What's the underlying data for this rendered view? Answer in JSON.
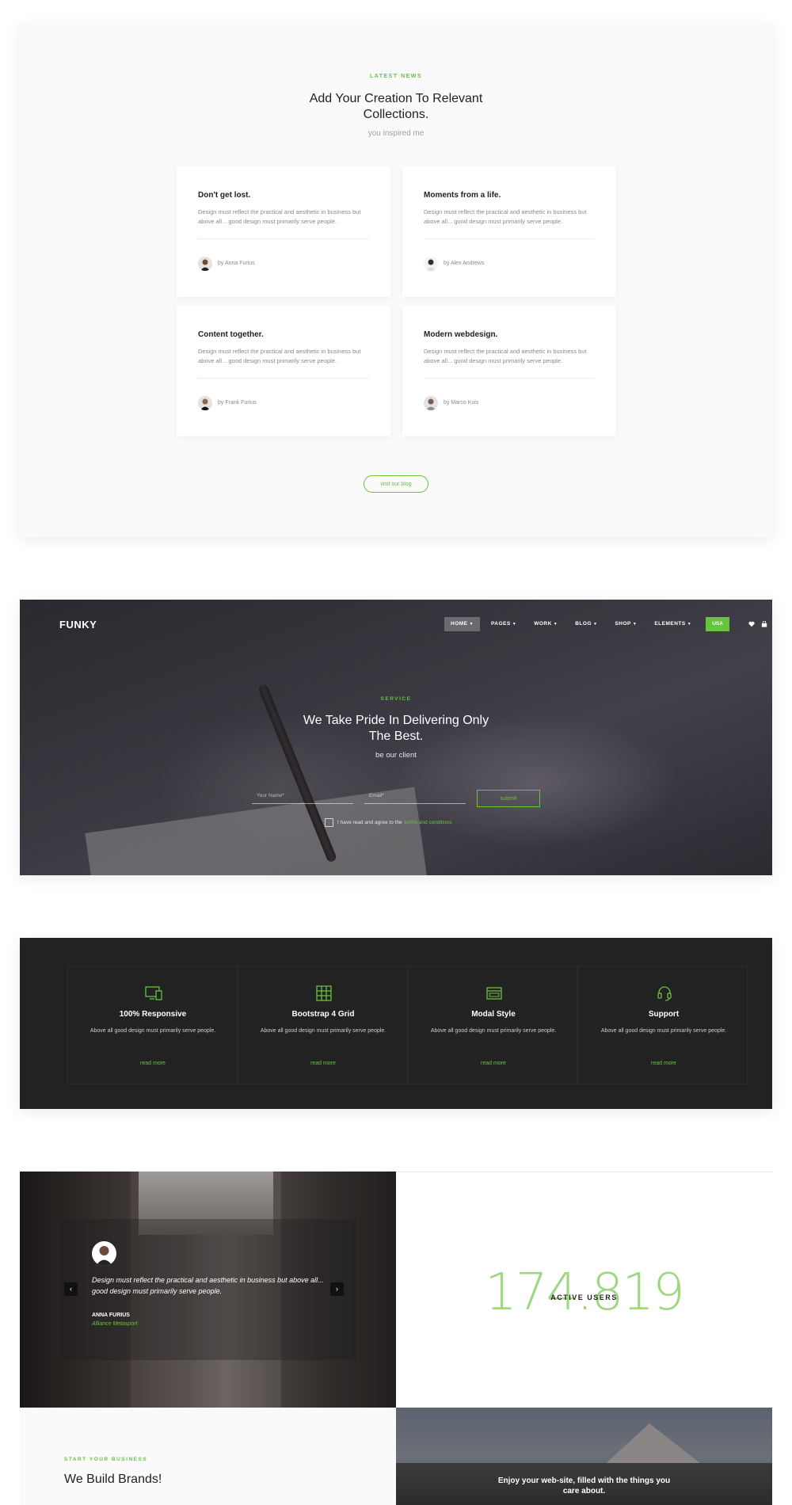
{
  "news": {
    "eyebrow": "LATEST NEWS",
    "title": "Add Your Creation To Relevant Collections.",
    "subtitle": "you inspired me",
    "cards": [
      {
        "title": "Don't get lost.",
        "text": "Design must reflect the practical and aesthetic in business but above all... good design must primarily serve people.",
        "author": "by Anna Furius"
      },
      {
        "title": "Moments from a life.",
        "text": "Design must reflect the practical and aesthetic in business but above all... good design must primarily serve people.",
        "author": "by Alex Andrews"
      },
      {
        "title": "Content together.",
        "text": "Design must reflect the practical and aesthetic in business but above all... good design must primarily serve people.",
        "author": "by Frank Furius"
      },
      {
        "title": "Modern webdesign.",
        "text": "Design must reflect the practical and aesthetic in business but above all... good design must primarily serve people.",
        "author": "by Marco Kuis"
      }
    ],
    "button": "visit our blog"
  },
  "hero": {
    "brand": "FUNKY",
    "nav": [
      {
        "label": "HOME"
      },
      {
        "label": "PAGES"
      },
      {
        "label": "WORK"
      },
      {
        "label": "BLOG"
      },
      {
        "label": "SHOP"
      },
      {
        "label": "ELEMENTS"
      }
    ],
    "cta": "USA",
    "icons": [
      "heart-icon",
      "bag-icon",
      "search-icon"
    ],
    "eyebrow": "SERVICE",
    "title": "We Take Pride In Delivering Only The Best.",
    "subtitle": "be our client",
    "name_placeholder": "Your Name*",
    "email_placeholder": "Email*",
    "submit": "submit",
    "terms_text": "I have read and agree to the",
    "terms_link": "terms and conditions"
  },
  "features": {
    "items": [
      {
        "icon": "monitor-icon",
        "title": "100% Responsive",
        "text": "Above all good design must primarily serve people.",
        "link": "read more"
      },
      {
        "icon": "grid-icon",
        "title": "Bootstrap 4 Grid",
        "text": "Above all good design must primarily serve people.",
        "link": "read more"
      },
      {
        "icon": "window-icon",
        "title": "Modal Style",
        "text": "Above all good design must primarily serve people.",
        "link": "read more"
      },
      {
        "icon": "headset-icon",
        "title": "Support",
        "text": "Above all good design must primarily serve people.",
        "link": "read more"
      }
    ]
  },
  "testimonial": {
    "quote": "Design must reflect the practical and aesthetic in business but above all... good design must primarily serve people.",
    "name": "ANNA FURIUS",
    "company": "Alliance Metasport"
  },
  "stats": {
    "number": "174.819",
    "label": "ACTIVE USERS"
  },
  "brands": {
    "eyebrow": "START YOUR BUSINESS",
    "title": "We Build Brands!"
  },
  "banner": {
    "text": "Enjoy your web-site, filled with the things you care about."
  },
  "colors": {
    "accent": "#68c33d",
    "dark": "#222222"
  }
}
